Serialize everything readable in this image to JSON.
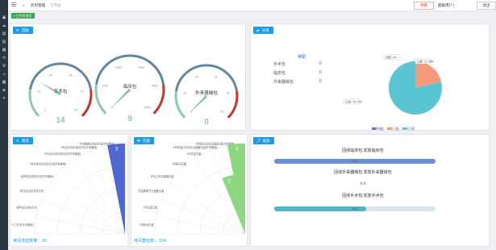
{
  "header": {
    "breadcrumb": [
      "药剂管理",
      "工作台"
    ],
    "alert_label": "预警",
    "user_label": "超级用户",
    "user_sep": "|",
    "logout_label": "退出"
  },
  "tag": {
    "label": "工作台首页"
  },
  "sidebar": {
    "icons": [
      "dashboard-icon",
      "cloud-icon",
      "file-icon",
      "folder-icon",
      "box-icon",
      "refresh-icon",
      "settings-icon",
      "user-icon",
      "chart-icon",
      "shield-icon",
      "cog-icon"
    ]
  },
  "panels": {
    "recycle": {
      "title": "回收",
      "gauges": [
        {
          "label": "手术包",
          "value": 14,
          "max": 50,
          "ticks": [
            "0",
            "10",
            "20",
            "30",
            "40",
            "50"
          ]
        },
        {
          "label": "临床包",
          "value": 9,
          "max": 5000,
          "ticks": [
            "0",
            "1000",
            "2000",
            "3000",
            "4000",
            "5000"
          ]
        },
        {
          "label": "外来器械包",
          "value": 0,
          "max": 50,
          "ticks": [
            "0",
            "10",
            "20",
            "30",
            "40",
            "50"
          ]
        }
      ]
    },
    "distribute": {
      "title": "分发",
      "column_header": "待配",
      "rows": [
        {
          "label": "手术包",
          "value": "0"
        },
        {
          "label": "临床包",
          "value": "0"
        },
        {
          "label": "外来器械包",
          "value": "0"
        }
      ],
      "chart_data": {
        "type": "pie",
        "labels": [
          "待配",
          "已配",
          "已领"
        ],
        "values": [
          0,
          21.26,
          78.74
        ],
        "value_labels": [
          "0%",
          "21.26%",
          "78.74%"
        ],
        "colors": [
          "#5b7bd5",
          "#f59a7d",
          "#5bc4d3"
        ]
      },
      "legend": [
        "待配",
        "已配",
        "已领"
      ]
    },
    "clean": {
      "title": "清洗",
      "categories": [
        "外来器械清洗机清洗(外来器械)",
        "1号全自动清洗机清洗(外来器械)",
        "2号全自动清洗机清洗(外来器械)",
        "3号全自动清洗机清洗(外来器械)",
        "超声波清洗机清洗(外来器械)",
        "3号全自动清洗机清洗",
        "超声波清洗机清洗",
        "人工清洗(外来器械)"
      ],
      "values": [
        3,
        0,
        0,
        0,
        0,
        0,
        0,
        0
      ],
      "value_label": "3",
      "footer_label": "待清洗包数量：",
      "footer_value": "24"
    },
    "sterilize": {
      "title": "灭菌",
      "categories": [
        "2号脉动真空灭菌器灭菌(外来器械)",
        "4号低温过氧化氢灭菌器灭菌(外来器械)",
        "4号低温灭菌",
        "3号脉动灭菌",
        "环氧乙烷灭菌器灭菌",
        "低温等离子灭菌器灭菌",
        "1号低温灭菌",
        "2号脉动灭菌"
      ],
      "values": [
        3,
        2,
        0,
        0,
        0,
        0,
        0,
        0
      ],
      "value_labels": [
        "3",
        "2"
      ],
      "footer_label": "待灭菌包数：",
      "footer_value": "154"
    },
    "issue": {
      "title": "发放",
      "items": [
        {
          "title": "回收临床包 发放临床包",
          "value_text": "9 9",
          "fraction": 1.0,
          "color": "#6f8ed8"
        },
        {
          "title": "回收外来器械包 发放外来器械包",
          "value_text": "0 0",
          "fraction": 0.0,
          "color": "#4fb8c4"
        },
        {
          "title": "回收手术包 发放手术包",
          "value_text": "14 0",
          "fraction": 0.57,
          "color": "#4fb8c4"
        }
      ]
    }
  }
}
